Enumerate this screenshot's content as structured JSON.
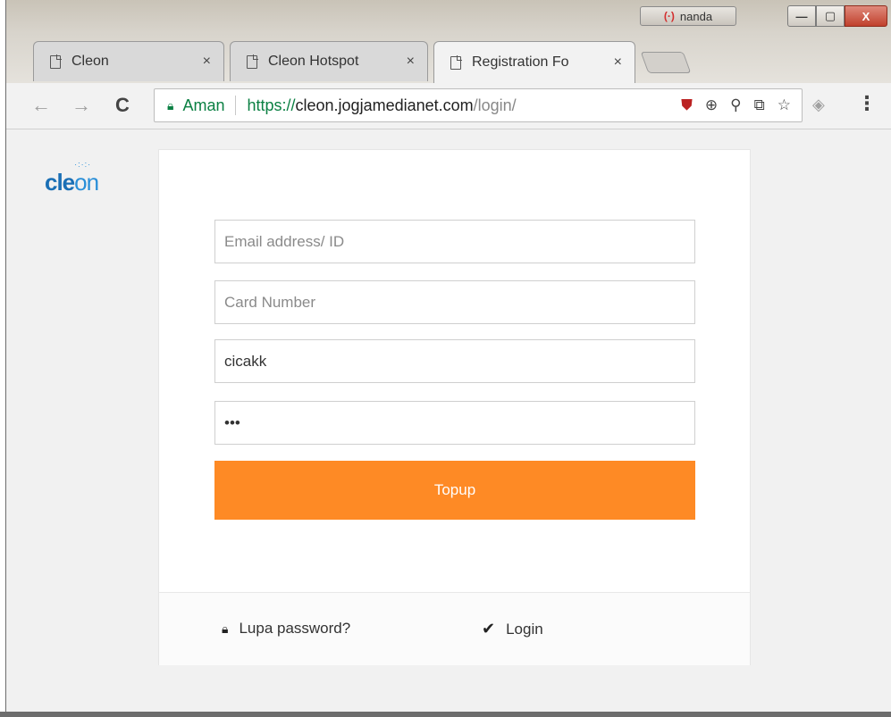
{
  "window": {
    "profile_name": "nanda",
    "profile_icon": "(·)",
    "controls": {
      "minimize": "—",
      "maximize": "▢",
      "close": "X"
    }
  },
  "tabs": [
    {
      "label": "Cleon",
      "close": "×"
    },
    {
      "label": "Cleon Hotspot",
      "close": "×"
    },
    {
      "label": "Registration Fo",
      "close": "×"
    }
  ],
  "toolbar": {
    "back": "←",
    "forward": "→",
    "reload": "C",
    "secure_label": "Aman",
    "url_scheme": "https://",
    "url_host": "cleon.jogjamedianet.com",
    "url_path": "/login/",
    "menu": "⋮"
  },
  "page": {
    "logo_text_1": "cle",
    "logo_text_2": "on",
    "logo_dots": "·:·:·",
    "form": {
      "email_placeholder": "Email address/ ID",
      "card_placeholder": "Card Number",
      "username_value": "cicakk",
      "password_value": "•••",
      "topup_label": "Topup"
    },
    "footer": {
      "forgot_label": "Lupa password?",
      "login_label": "Login"
    }
  }
}
